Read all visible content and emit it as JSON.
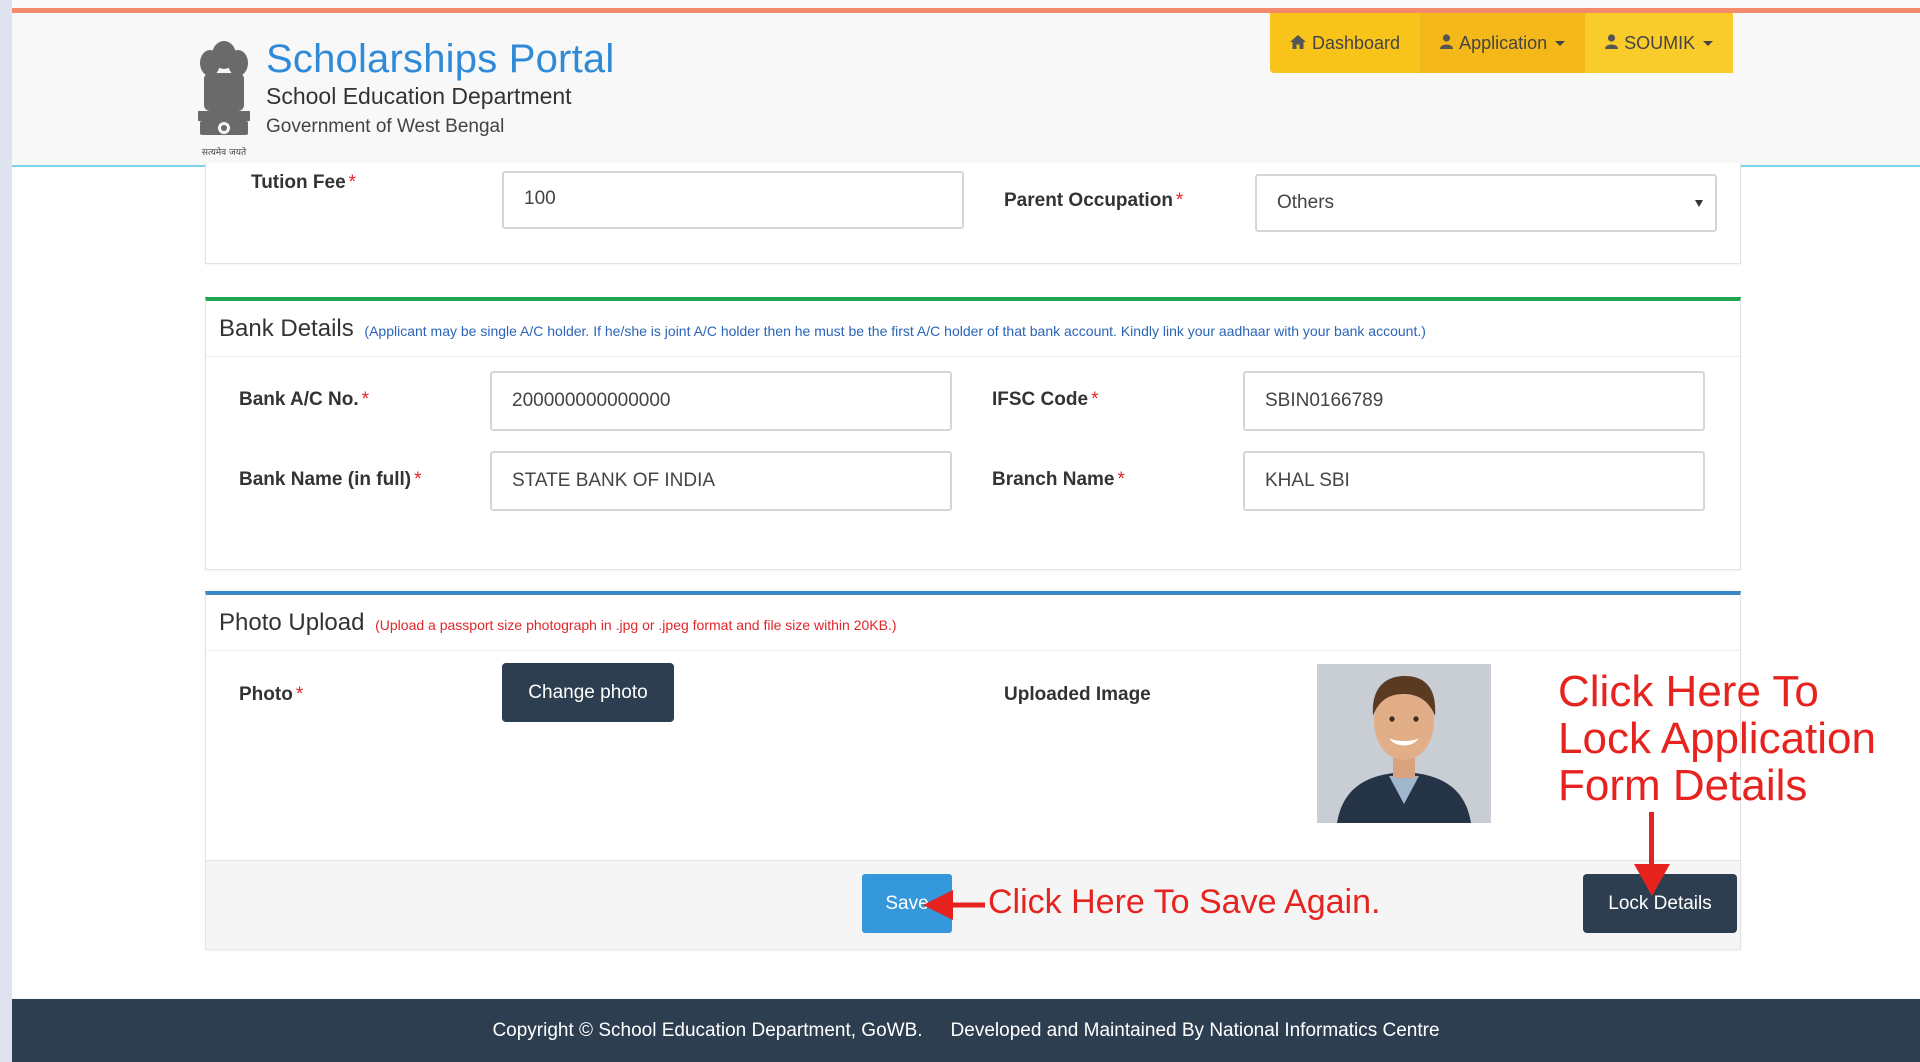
{
  "header": {
    "title": "Scholarships Portal",
    "subtitle": "School Education Department",
    "org": "Government of West Bengal",
    "emblem_caption": "सत्यमेव जयते"
  },
  "nav": {
    "items": [
      {
        "label": "Dashboard",
        "icon": "home-icon"
      },
      {
        "label": "Application",
        "icon": "user-icon"
      },
      {
        "label": "SOUMIK",
        "icon": "user-icon"
      }
    ]
  },
  "form_top": {
    "tuition_fee_label": "Tution Fee",
    "tuition_fee_value": "100",
    "parent_occupation_label": "Parent Occupation",
    "parent_occupation_value": "Others"
  },
  "bank": {
    "title": "Bank Details",
    "note": "(Applicant may be single A/C holder. If he/she is joint A/C holder then he must be the first A/C holder of that bank account. Kindly link your aadhaar with your bank account.)",
    "account_label": "Bank A/C No.",
    "account_value": "200000000000000",
    "ifsc_label": "IFSC Code",
    "ifsc_value": "SBIN0166789",
    "bank_name_label": "Bank Name (in full)",
    "bank_name_value": "STATE BANK OF INDIA",
    "branch_label": "Branch Name",
    "branch_value": "KHAL SBI"
  },
  "photo": {
    "title": "Photo Upload",
    "note": "(Upload a passport size photograph in .jpg or .jpeg format and file size within 20KB.)",
    "photo_label": "Photo",
    "change_button": "Change photo",
    "uploaded_label": "Uploaded Image"
  },
  "actions": {
    "save": "Save",
    "lock": "Lock Details"
  },
  "annotations": {
    "save_hint": "Click Here To Save Again.",
    "lock_hint_line1": "Click Here To",
    "lock_hint_line2": "Lock Application",
    "lock_hint_line3": "Form Details"
  },
  "footer": {
    "copyright": "Copyright © School Education Department, GoWB.",
    "developer": "Developed and Maintained By National Informatics Centre"
  },
  "required_mark": "*",
  "colors": {
    "brand_blue": "#2f8ad8",
    "nav_yellow": "#f8c41a",
    "bank_accent": "#23a455",
    "photo_accent": "#3a87c8",
    "annotation_red": "#e6231f",
    "dark_button": "#2c3e50"
  }
}
